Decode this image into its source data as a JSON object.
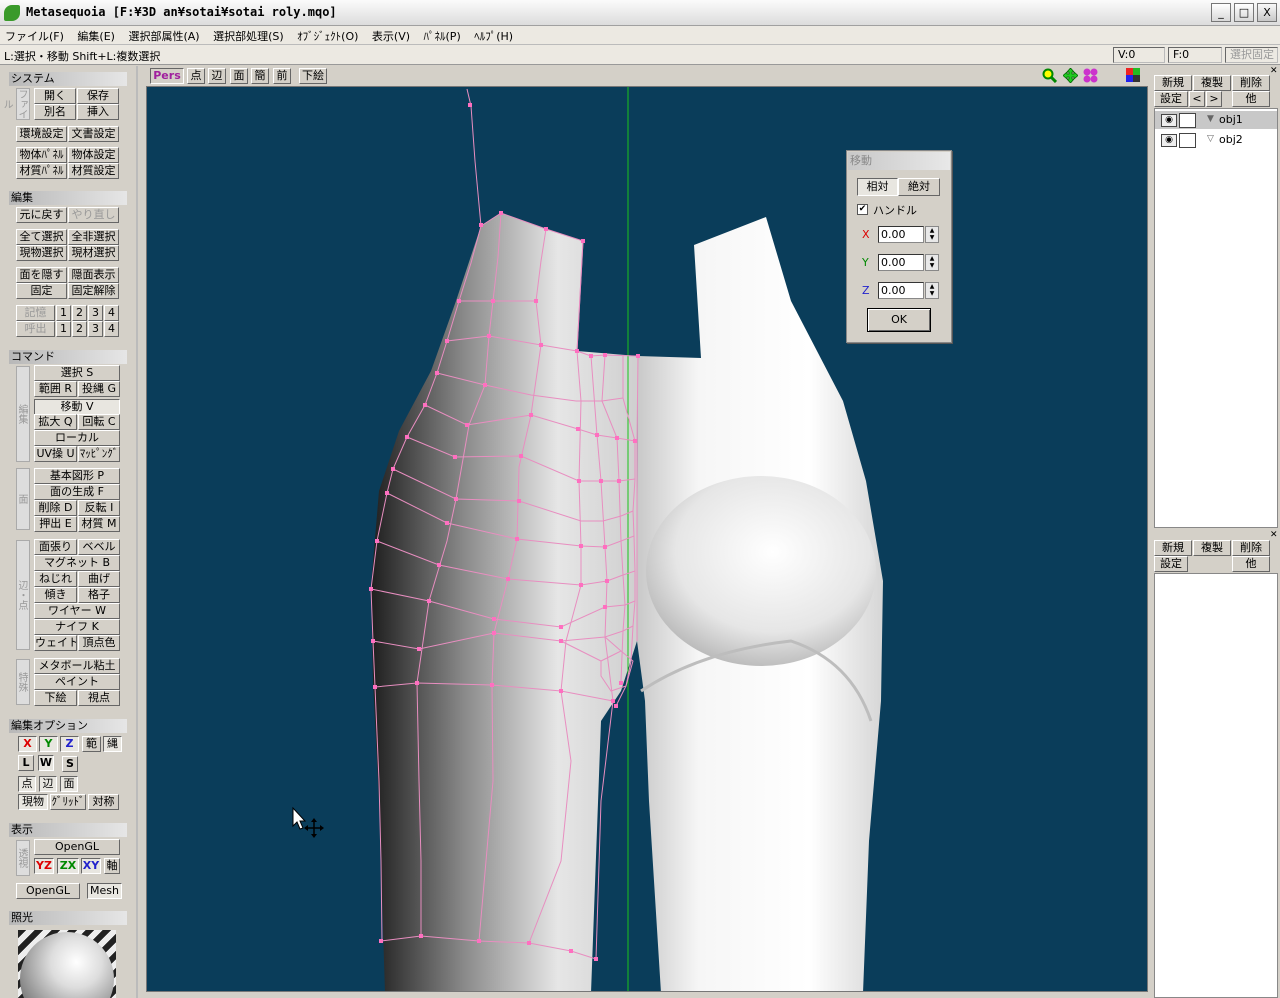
{
  "window": {
    "title": "Metasequoia [F:¥3D an¥sotai¥sotai roly.mqo]",
    "min_btn": "_",
    "max_btn": "□",
    "close_btn": "X"
  },
  "menu": [
    "ファイル(F)",
    "編集(E)",
    "選択部属性(A)",
    "選択部処理(S)",
    "ｵﾌﾞｼﾞｪｸﾄ(O)",
    "表示(V)",
    "ﾊﾟﾈﾙ(P)",
    "ﾍﾙﾌﾟ(H)"
  ],
  "status": {
    "hint": "L:選択・移動  Shift+L:複数選択",
    "v": "V:0",
    "f": "F:0",
    "lock": "選択固定"
  },
  "left": {
    "system": {
      "title": "システム",
      "tag": "ファイル",
      "open": "開く",
      "save": "保存",
      "saveas": "別名",
      "insert": "挿入",
      "env": "環境設定",
      "doc": "文書設定",
      "objpanel": "物体ﾊﾟﾈﾙ",
      "objset": "物体設定",
      "matpanel": "材質ﾊﾟﾈﾙ",
      "matset": "材質設定"
    },
    "edit": {
      "title": "編集",
      "undo": "元に戻す",
      "redo": "やり直し",
      "selall": "全て選択",
      "selnone": "全非選択",
      "curobj": "現物選択",
      "curmat": "現材選択",
      "hide": "面を隠す",
      "show": "隠面表示",
      "fix": "固定",
      "unfix": "固定解除",
      "mem": "記憶",
      "recall": "呼出",
      "n1": "1",
      "n2": "2",
      "n3": "3",
      "n4": "4"
    },
    "command": {
      "title": "コマンド",
      "tag1": "編集",
      "tag2": "面",
      "tag3": "辺・点",
      "tag4": "特殊",
      "select": "選択 S",
      "range": "範囲 R",
      "lasso": "投縄 G",
      "move": "移動 V",
      "scale": "拡大 Q",
      "rotate": "回転 C",
      "local": "ローカル",
      "uv": "UV操 U",
      "mapping": "ﾏｯﾋﾟﾝｸﾞ",
      "prim": "基本図形 P",
      "face": "面の生成 F",
      "del": "削除 D",
      "flip": "反転 I",
      "extrude": "押出 E",
      "mat": "材質 M",
      "facestretch": "面張り",
      "bevel": "ベベル",
      "magnet": "マグネット B",
      "twist": "ねじれ",
      "bend": "曲げ",
      "slant": "傾き",
      "lattice": "格子",
      "wire": "ワイヤー W",
      "knife": "ナイフ K",
      "weight": "ウェイト",
      "vcolor": "頂点色",
      "metaball": "メタボール粘土",
      "paint": "ペイント",
      "bg": "下絵",
      "view": "視点"
    },
    "opts": {
      "title": "編集オプション",
      "x": "X",
      "y": "Y",
      "z": "Z",
      "range": "範",
      "rope": "縄",
      "l": "L",
      "w": "W",
      "s": "S",
      "pt": "点",
      "edge": "辺",
      "face": "面",
      "cur": "現物",
      "grid": "ｸﾞﾘｯﾄﾞ",
      "sym": "対称"
    },
    "display": {
      "title": "表示",
      "tag": "透視",
      "opengl": "OpenGL",
      "yz": "YZ",
      "zx": "ZX",
      "xy": "XY",
      "axis": "軸",
      "opengl2": "OpenGL",
      "mesh": "Mesh"
    },
    "light": {
      "title": "照光"
    }
  },
  "viewport": {
    "pers": "Pers",
    "pt": "点",
    "edge": "辺",
    "face": "面",
    "simple": "簡",
    "front": "前",
    "bg": "下絵"
  },
  "move_dialog": {
    "title": "移動",
    "rel": "相対",
    "abs": "絶対",
    "handle": "ハンドル",
    "x_label": "X",
    "x": "0.00",
    "y_label": "Y",
    "y": "0.00",
    "z_label": "Z",
    "z": "0.00",
    "ok": "OK"
  },
  "objects": {
    "new": "新規",
    "copy": "複製",
    "delete": "削除",
    "settings": "設定",
    "prev": "<",
    "next": ">",
    "other": "他",
    "items": [
      "obj1",
      "obj2"
    ]
  },
  "materials": {
    "new": "新規",
    "copy": "複製",
    "delete": "削除",
    "settings": "設定",
    "other": "他"
  },
  "colors": {
    "viewport_bg": "#0a3d5a",
    "wire": "#e88ec0",
    "axis_green": "#19c419"
  }
}
